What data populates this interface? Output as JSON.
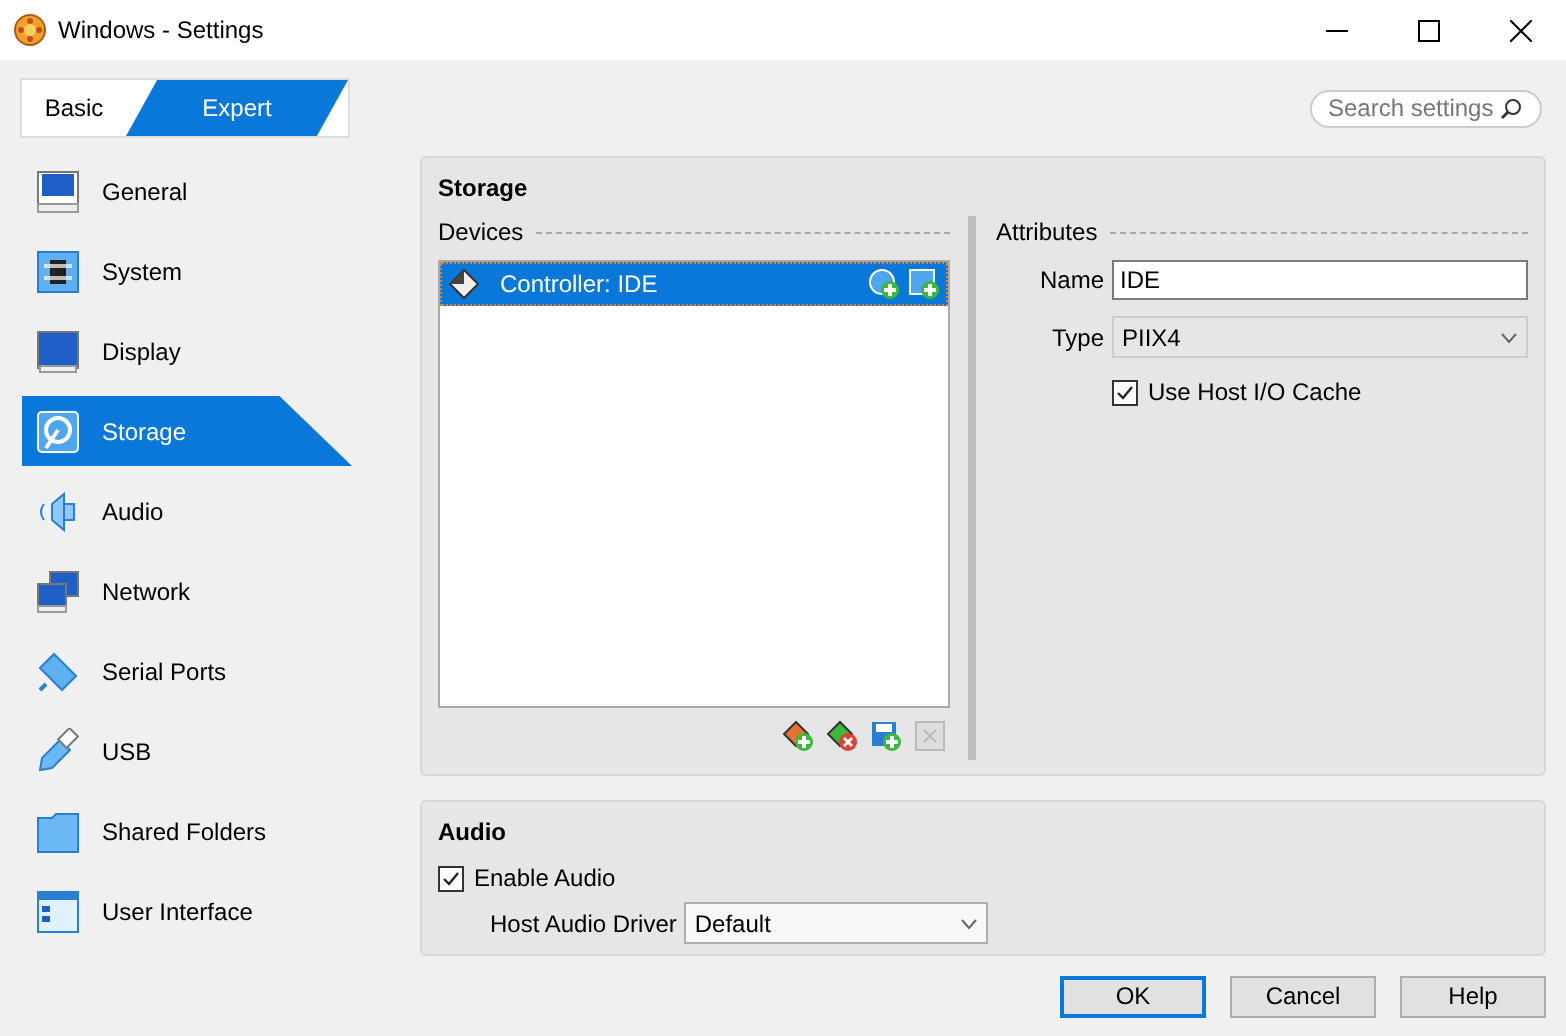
{
  "window": {
    "title": "Windows - Settings"
  },
  "modes": [
    {
      "label": "Basic",
      "selected": false
    },
    {
      "label": "Expert",
      "selected": true
    }
  ],
  "search": {
    "placeholder": "Search settings"
  },
  "sidebar": {
    "items": [
      {
        "label": "General",
        "selected": false
      },
      {
        "label": "System",
        "selected": false
      },
      {
        "label": "Display",
        "selected": false
      },
      {
        "label": "Storage",
        "selected": true
      },
      {
        "label": "Audio",
        "selected": false
      },
      {
        "label": "Network",
        "selected": false
      },
      {
        "label": "Serial Ports",
        "selected": false
      },
      {
        "label": "USB",
        "selected": false
      },
      {
        "label": "Shared Folders",
        "selected": false
      },
      {
        "label": "User Interface",
        "selected": false
      }
    ]
  },
  "storage": {
    "title": "Storage",
    "devices": {
      "title": "Devices",
      "items": [
        {
          "label": "Controller: IDE",
          "selected": true
        }
      ]
    },
    "attributes": {
      "title": "Attributes",
      "name": {
        "label": "Name",
        "value": "IDE"
      },
      "type": {
        "label": "Type",
        "value": "PIIX4"
      },
      "host_io_cache": {
        "label": "Use Host I/O Cache",
        "checked": true
      }
    }
  },
  "audio": {
    "title": "Audio",
    "enable": {
      "label": "Enable Audio",
      "checked": true
    },
    "driver": {
      "label": "Host Audio Driver",
      "value": "Default"
    }
  },
  "buttons": [
    {
      "label": "OK",
      "default": true
    },
    {
      "label": "Cancel",
      "default": false
    },
    {
      "label": "Help",
      "default": false
    }
  ]
}
